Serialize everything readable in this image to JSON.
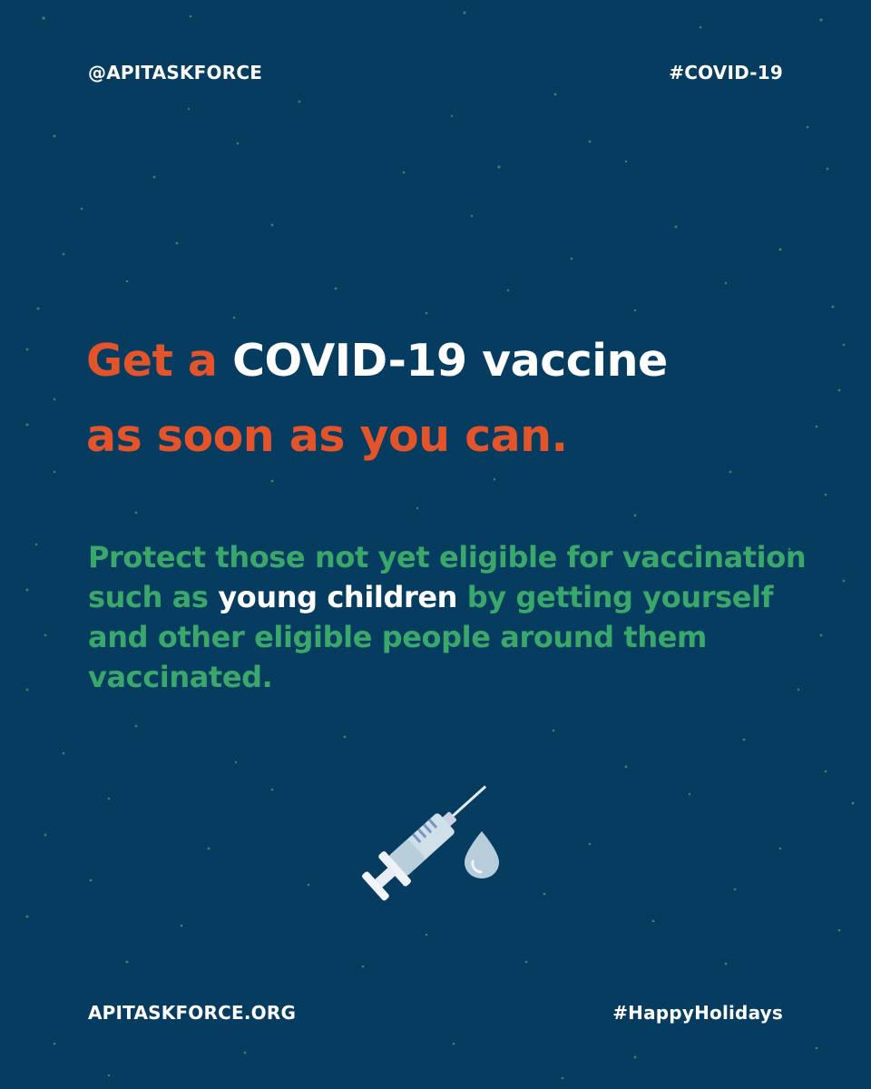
{
  "header": {
    "handle": "@APITASKFORCE",
    "hashtag": "#COVID-19"
  },
  "headline": {
    "part1": "Get a ",
    "part2": "COVID-19 vaccine",
    "part3": "as soon as you can."
  },
  "body": {
    "line1_a": "Protect those not yet eligible for vaccination such as ",
    "highlight": "young children",
    "line1_b": " by getting yourself and other eligible people around them vaccinated."
  },
  "footer": {
    "website": "APITASKFORCE.ORG",
    "hashtag": "#HappyHolidays"
  },
  "colors": {
    "background": "#063c60",
    "accent_orange": "#e4542a",
    "accent_green": "#3aa86a",
    "text_white": "#ffffff"
  },
  "icons": {
    "syringe": "syringe-icon",
    "drop": "drop-icon"
  }
}
